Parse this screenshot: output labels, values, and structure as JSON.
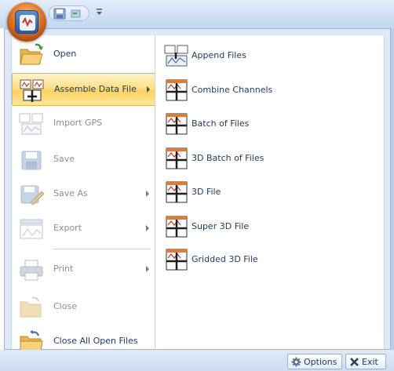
{
  "menu": {
    "items": [
      {
        "label": "Open",
        "icon": "folder-open-icon",
        "enabled": true,
        "submenu": false
      },
      {
        "label": "Assemble Data File",
        "icon": "assemble-data-icon",
        "enabled": true,
        "submenu": true,
        "selected": true
      },
      {
        "label": "Import GPS",
        "icon": "import-gps-icon",
        "enabled": false,
        "submenu": false
      },
      {
        "label": "Save",
        "icon": "save-disk-icon",
        "enabled": false,
        "submenu": false
      },
      {
        "label": "Save As",
        "icon": "save-as-icon",
        "enabled": false,
        "submenu": true
      },
      {
        "label": "Export",
        "icon": "export-icon",
        "enabled": false,
        "submenu": true
      },
      {
        "label": "Print",
        "icon": "printer-icon",
        "enabled": false,
        "submenu": true
      },
      {
        "label": "Close",
        "icon": "close-folder-icon",
        "enabled": false,
        "submenu": false
      },
      {
        "label": "Close All Open Files",
        "icon": "close-all-folder-icon",
        "enabled": true,
        "submenu": false
      }
    ]
  },
  "submenu": {
    "items": [
      {
        "label": "Append Files",
        "icon": "append-files-icon"
      },
      {
        "label": "Combine Channels",
        "icon": "combine-channels-icon"
      },
      {
        "label": "Batch of Files",
        "icon": "batch-files-icon"
      },
      {
        "label": "3D Batch of Files",
        "icon": "batch-3d-files-icon"
      },
      {
        "label": "3D File",
        "icon": "file-3d-icon"
      },
      {
        "label": "Super 3D File",
        "icon": "super-3d-file-icon"
      },
      {
        "label": "Gridded 3D File",
        "icon": "gridded-3d-file-icon"
      }
    ]
  },
  "footer": {
    "options_label": "Options",
    "exit_label": "Exit"
  },
  "colors": {
    "selected_highlight": "#ffd25a",
    "text": "#1e395b",
    "disabled_text": "#8d8d8d",
    "app_button": "#e0782c"
  }
}
